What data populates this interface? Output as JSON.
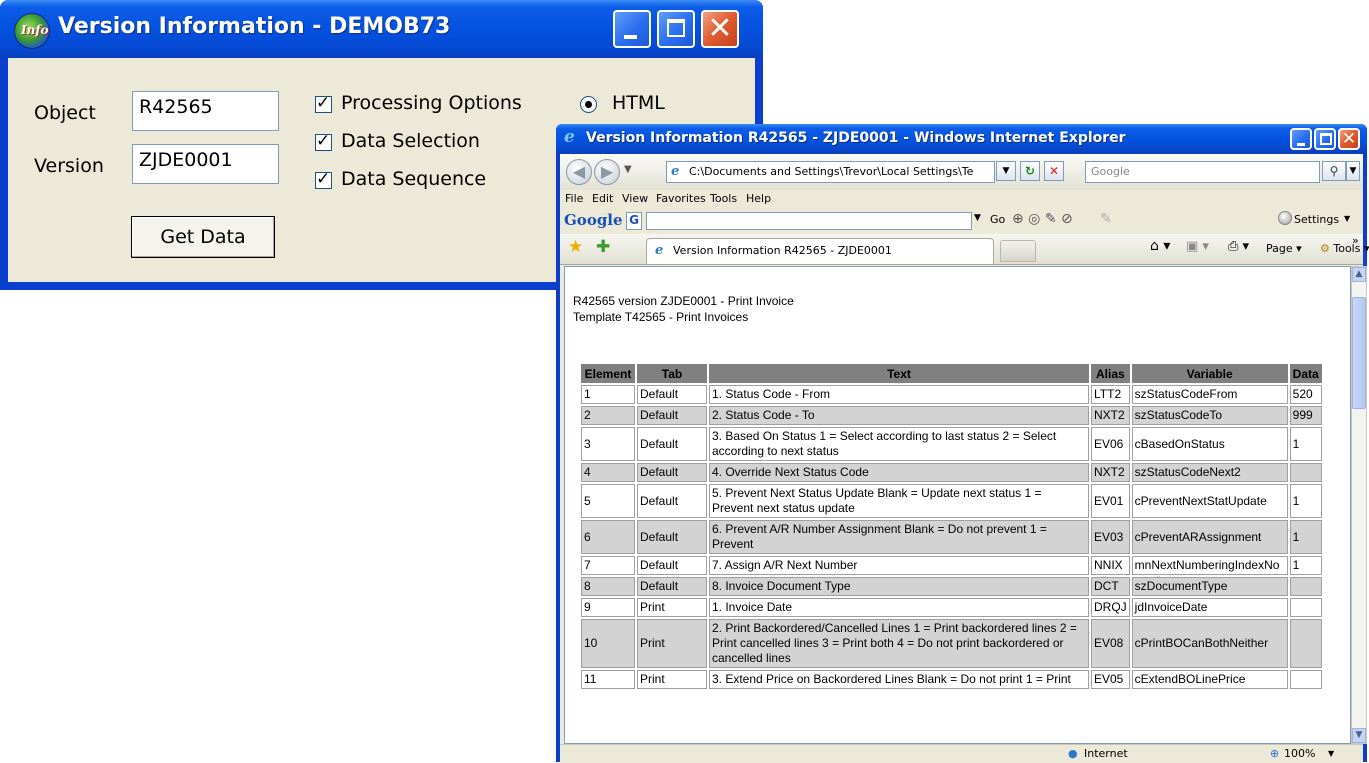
{
  "version_dialog": {
    "title": "Version Information - DEMOB73",
    "icon_text": "Info",
    "object_label": "Object",
    "object_value": "R42565",
    "version_label": "Version",
    "version_value": "ZJDE0001",
    "checks": {
      "processing_options": "Processing Options",
      "data_selection": "Data Selection",
      "data_sequence": "Data Sequence"
    },
    "radio_html": "HTML",
    "get_data": "Get Data"
  },
  "ie": {
    "title": "Version Information R42565 - ZJDE0001 - Windows Internet Explorer",
    "address": "C:\\Documents and Settings\\Trevor\\Local Settings\\Te",
    "search_placeholder": "Google",
    "menus": [
      "File",
      "Edit",
      "View",
      "Favorites",
      "Tools",
      "Help"
    ],
    "google_logo": "Google",
    "google_go": "Go",
    "settings": "Settings",
    "tab_title": "Version Information R42565 - ZJDE0001",
    "page_menu": "Page",
    "tools_menu": "Tools",
    "status_zone": "Internet",
    "zoom": "100%"
  },
  "document": {
    "line1": "R42565 version ZJDE0001 - Print Invoice",
    "line2": "Template T42565 - Print Invoices",
    "columns": [
      "Element",
      "Tab",
      "Text",
      "Alias",
      "Variable",
      "Data"
    ],
    "rows": [
      [
        "1",
        "Default",
        "1. Status Code - From",
        "LTT2",
        "szStatusCodeFrom",
        "520"
      ],
      [
        "2",
        "Default",
        "2. Status Code - To",
        "NXT2",
        "szStatusCodeTo",
        "999"
      ],
      [
        "3",
        "Default",
        "3. Based On Status 1 = Select according to last status 2 = Select according to next status",
        "EV06",
        "cBasedOnStatus",
        "1"
      ],
      [
        "4",
        "Default",
        "4. Override Next Status Code",
        "NXT2",
        "szStatusCodeNext2",
        ""
      ],
      [
        "5",
        "Default",
        "5. Prevent Next Status Update Blank = Update next status 1 = Prevent next status update",
        "EV01",
        "cPreventNextStatUpdate",
        "1"
      ],
      [
        "6",
        "Default",
        "6. Prevent A/R Number Assignment Blank = Do not prevent 1 = Prevent",
        "EV03",
        "cPreventARAssignment",
        "1"
      ],
      [
        "7",
        "Default",
        "7. Assign A/R Next Number",
        "NNIX",
        "mnNextNumberingIndexNo",
        "1"
      ],
      [
        "8",
        "Default",
        "8. Invoice Document Type",
        "DCT",
        "szDocumentType",
        ""
      ],
      [
        "9",
        "Print",
        "1. Invoice Date",
        "DRQJ",
        "jdInvoiceDate",
        ""
      ],
      [
        "10",
        "Print",
        "2. Print Backordered/Cancelled Lines 1 = Print backordered lines 2 = Print cancelled lines 3 = Print both 4 = Do not print backordered or cancelled lines",
        "EV08",
        "cPrintBOCanBothNeither",
        ""
      ],
      [
        "11",
        "Print",
        "3. Extend Price on Backordered Lines Blank = Do not print 1 = Print",
        "EV05",
        "cExtendBOLinePrice",
        ""
      ]
    ]
  }
}
